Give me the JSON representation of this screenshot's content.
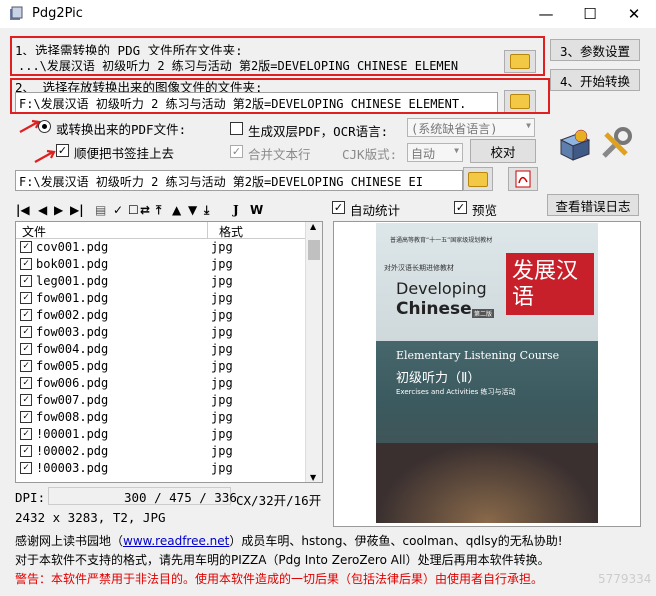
{
  "window": {
    "title": "Pdg2Pic",
    "min": "—",
    "max": "☐",
    "close": "✕"
  },
  "step1": {
    "label": "1、选择需转换的 PDG 文件所在文件夹:",
    "path": "...\\发展汉语 初级听力 2 练习与活动 第2版=DEVELOPING CHINESE ELEMEN"
  },
  "step2": {
    "label": "2、 选择存放转换出来的图像文件的文件夹:",
    "path": "F:\\发展汉语 初级听力 2 练习与活动 第2版=DEVELOPING CHINESE ELEMENT."
  },
  "buttons": {
    "params": "3、参数设置",
    "start": "4、开始转换",
    "verify": "校对",
    "errorlog": "查看错误日志"
  },
  "options": {
    "pdf_radio": "或转换出来的PDF文件:",
    "bookmark": "顺便把书签挂上去",
    "dual_layer": "生成双层PDF，OCR语言:",
    "ocr_lang": "(系统缺省语言)",
    "merge_text": "合并文本行",
    "cjk_label": "CJK版式:",
    "cjk_value": "自动",
    "pdf_path": "F:\\发展汉语 初级听力 2 练习与活动 第2版=DEVELOPING CHINESE EI"
  },
  "toolbar": {
    "auto_stat": "自动统计",
    "preview": "预览"
  },
  "list": {
    "col_file": "文件",
    "col_fmt": "格式",
    "rows": [
      {
        "file": "cov001.pdg",
        "fmt": "jpg"
      },
      {
        "file": "bok001.pdg",
        "fmt": "jpg"
      },
      {
        "file": "leg001.pdg",
        "fmt": "jpg"
      },
      {
        "file": "fow001.pdg",
        "fmt": "jpg"
      },
      {
        "file": "fow002.pdg",
        "fmt": "jpg"
      },
      {
        "file": "fow003.pdg",
        "fmt": "jpg"
      },
      {
        "file": "fow004.pdg",
        "fmt": "jpg"
      },
      {
        "file": "fow005.pdg",
        "fmt": "jpg"
      },
      {
        "file": "fow006.pdg",
        "fmt": "jpg"
      },
      {
        "file": "fow007.pdg",
        "fmt": "jpg"
      },
      {
        "file": "fow008.pdg",
        "fmt": "jpg"
      },
      {
        "file": "!00001.pdg",
        "fmt": "jpg"
      },
      {
        "file": "!00002.pdg",
        "fmt": "jpg"
      },
      {
        "file": "!00003.pdg",
        "fmt": "jpg"
      }
    ]
  },
  "status": {
    "dpi_label": "DPI:",
    "dpi_value": "300 / 475 / 336",
    "count": "CX/32开/16开",
    "info": "2432 x 3283, T2, JPG"
  },
  "cover": {
    "publisher": "普通高等教育“十一五”国家级规划教材",
    "series": "对外汉语长期进修教材",
    "title_cn": "发展汉语",
    "title_en1": "Developing",
    "title_en2": "Chinese",
    "edition": "第二版",
    "course": "Elementary Listening Course",
    "sub_cn": "初级听力（Ⅱ）",
    "sub_en": "Exercises and Activities 练习与活动"
  },
  "footer": {
    "thanks_a": "感谢网上读书园地（",
    "thanks_link": "www.readfree.net",
    "thanks_b": "）成员车明、hstong、伊莜鱼、coolman、qdlsy的无私协助!",
    "note": "对于本软件不支持的格式，请先用车明的PIZZA（Pdg Into ZeroZero All）处理后再用本软件转换。",
    "warning": "警告：本软件严禁用于非法目的。使用本软件造成的一切后果（包括法律后果）由使用者自行承担。",
    "watermark": "5779334"
  }
}
